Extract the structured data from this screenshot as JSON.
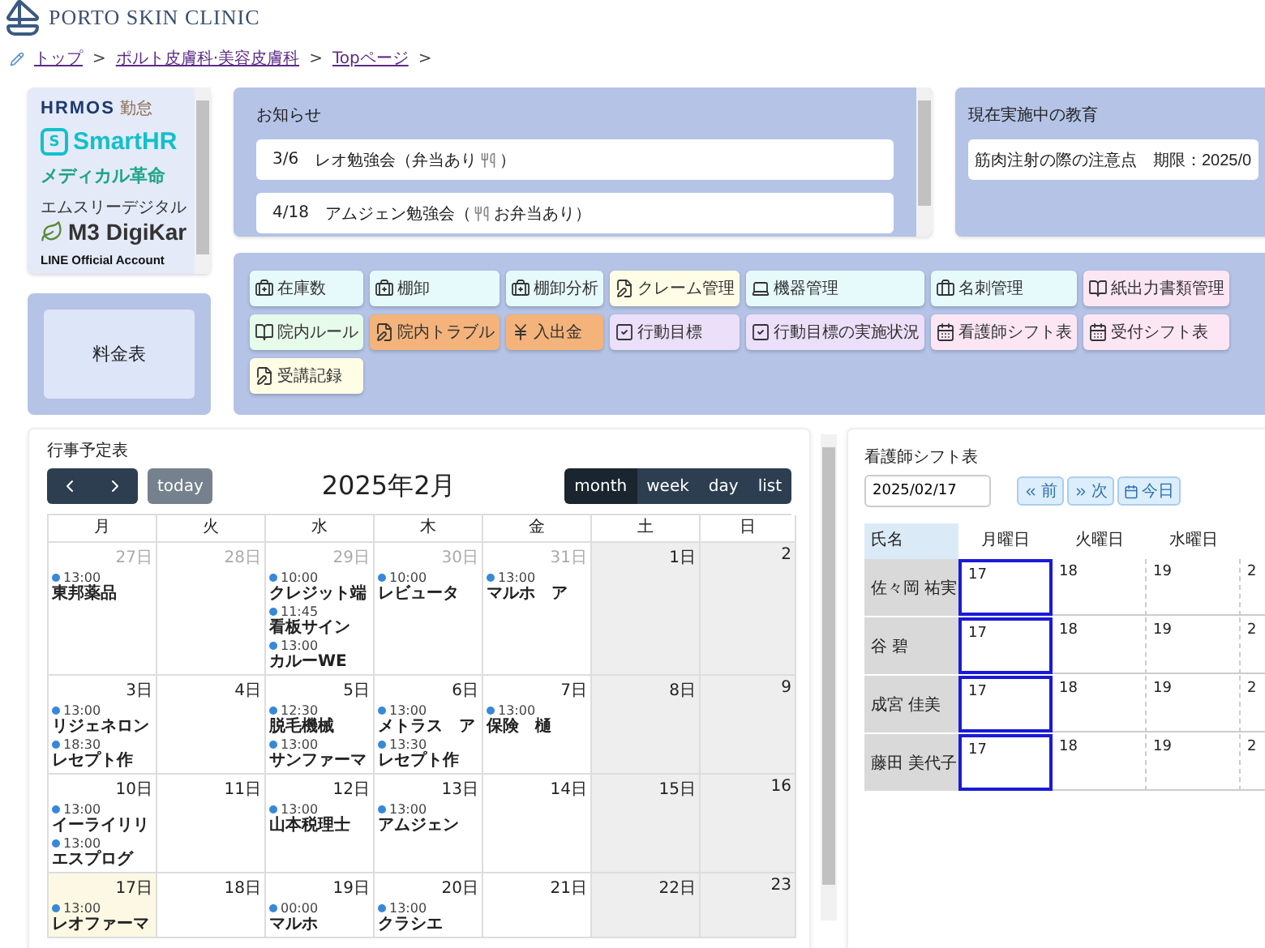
{
  "header": {
    "clinic_name": "PORTO SKIN CLINIC"
  },
  "breadcrumb": [
    {
      "label": "トップ",
      "separator": ">"
    },
    {
      "label": "ポルト皮膚科·美容皮膚科",
      "separator": ">"
    },
    {
      "label": "Topページ",
      "separator": ">"
    }
  ],
  "logos": [
    {
      "kind": "hrmos",
      "name": "HRMOS",
      "sub": "勤怠"
    },
    {
      "kind": "smarthr",
      "mark": "S",
      "name": "SmartHR"
    },
    {
      "kind": "medical",
      "name": "メディカル革命"
    },
    {
      "kind": "m3",
      "kana": "エムスリーデジタル",
      "name": "M3 DigiKar"
    },
    {
      "kind": "line",
      "name": "LINE Official Account"
    }
  ],
  "fee_panel": {
    "label": "料金表"
  },
  "notices": {
    "title": "お知らせ",
    "items": [
      {
        "date": "3/6",
        "before": "レオ勉強会（弁当あり",
        "after": "）"
      },
      {
        "date": "4/18",
        "before": "アムジェン勉強会（",
        "after": "お弁当あり）"
      }
    ]
  },
  "education": {
    "title": "現在実施中の教育",
    "items": [
      "筋肉注射の際の注意点　期限：2025/0"
    ]
  },
  "shortcuts": [
    {
      "label": "在庫数",
      "kind": "kit",
      "color": "#e6fafc"
    },
    {
      "label": "棚卸",
      "kind": "kit",
      "color": "#e6fafc"
    },
    {
      "label": "棚卸分析",
      "kind": "kit",
      "color": "#e6fafc"
    },
    {
      "label": "クレーム管理",
      "kind": "doc",
      "color": "#fffde6"
    },
    {
      "label": "機器管理",
      "kind": "laptop",
      "color": "#e6fafc"
    },
    {
      "label": "名刺管理",
      "kind": "briefcase",
      "color": "#e6fafc"
    },
    {
      "label": "紙出力書類管理",
      "kind": "book",
      "color": "#fde6f4"
    },
    {
      "label": "院内ルール",
      "kind": "book",
      "color": "#e6fbe9"
    },
    {
      "label": "院内トラブル",
      "kind": "doc",
      "color": "#f4b37a"
    },
    {
      "label": "入出金",
      "kind": "yen",
      "color": "#f4b37a"
    },
    {
      "label": "行動目標",
      "kind": "check",
      "color": "#ecdff9"
    },
    {
      "label": "行動目標の実施状況",
      "kind": "check",
      "color": "#ecdff9"
    },
    {
      "label": "看護師シフト表",
      "kind": "calendar",
      "color": "#fde6f4"
    },
    {
      "label": "受付シフト表",
      "kind": "calendar",
      "color": "#fde6f4"
    },
    {
      "label": "受講記録",
      "kind": "doc",
      "color": "#fffde6"
    }
  ],
  "calendar": {
    "title": "行事予定表",
    "month": "2025年2月",
    "today_label": "today",
    "today_disabled": true,
    "views": [
      {
        "label": "month",
        "selected": true
      },
      {
        "label": "week",
        "selected": false
      },
      {
        "label": "day",
        "selected": false
      },
      {
        "label": "list",
        "selected": false
      }
    ],
    "weekdays": [
      {
        "label": "月",
        "weekend": false
      },
      {
        "label": "火",
        "weekend": false
      },
      {
        "label": "水",
        "weekend": false
      },
      {
        "label": "木",
        "weekend": false
      },
      {
        "label": "金",
        "weekend": false
      },
      {
        "label": "土",
        "weekend": true
      },
      {
        "label": "日",
        "weekend": true
      }
    ],
    "weeks": [
      [
        {
          "day": "27日",
          "other_month": true,
          "today": false,
          "events": [
            {
              "time": "13:00",
              "title": "東邦薬品"
            }
          ]
        },
        {
          "day": "28日",
          "other_month": true,
          "today": false
        },
        {
          "day": "29日",
          "other_month": true,
          "today": false,
          "events": [
            {
              "time": "10:00",
              "title": "クレジット端"
            },
            {
              "time": "11:45",
              "title": "看板サイン"
            },
            {
              "time": "13:00",
              "title": "カルーWE"
            }
          ]
        },
        {
          "day": "30日",
          "other_month": true,
          "today": false,
          "events": [
            {
              "time": "10:00",
              "title": "レビュータ"
            }
          ]
        },
        {
          "day": "31日",
          "other_month": true,
          "today": false,
          "events": [
            {
              "time": "13:00",
              "title": "マルホ　ア"
            }
          ]
        },
        {
          "day": "1日",
          "other_month": false,
          "today": false
        },
        {
          "day": "2",
          "other_month": false,
          "today": false
        }
      ],
      [
        {
          "day": "3日",
          "other_month": false,
          "today": false,
          "events": [
            {
              "time": "13:00",
              "title": "リジェネロン"
            },
            {
              "time": "18:30",
              "title": "レセプト作"
            }
          ]
        },
        {
          "day": "4日",
          "other_month": false,
          "today": false
        },
        {
          "day": "5日",
          "other_month": false,
          "today": false,
          "events": [
            {
              "time": "12:30",
              "title": "脱毛機械"
            },
            {
              "time": "13:00",
              "title": "サンファーマ"
            }
          ]
        },
        {
          "day": "6日",
          "other_month": false,
          "today": false,
          "events": [
            {
              "time": "13:00",
              "title": "メトラス　ア"
            },
            {
              "time": "13:30",
              "title": "レセプト作"
            }
          ]
        },
        {
          "day": "7日",
          "other_month": false,
          "today": false,
          "events": [
            {
              "time": "13:00",
              "title": "保険　樋"
            }
          ]
        },
        {
          "day": "8日",
          "other_month": false,
          "today": false
        },
        {
          "day": "9",
          "other_month": false,
          "today": false
        }
      ],
      [
        {
          "day": "10日",
          "other_month": false,
          "today": false,
          "events": [
            {
              "time": "13:00",
              "title": "イーライリリ"
            },
            {
              "time": "13:00",
              "title": "エスプログ"
            }
          ]
        },
        {
          "day": "11日",
          "other_month": false,
          "today": false
        },
        {
          "day": "12日",
          "other_month": false,
          "today": false,
          "events": [
            {
              "time": "13:00",
              "title": "山本税理士"
            }
          ]
        },
        {
          "day": "13日",
          "other_month": false,
          "today": false,
          "events": [
            {
              "time": "13:00",
              "title": "アムジェン"
            }
          ]
        },
        {
          "day": "14日",
          "other_month": false,
          "today": false
        },
        {
          "day": "15日",
          "other_month": false,
          "today": false
        },
        {
          "day": "16",
          "other_month": false,
          "today": false
        }
      ],
      [
        {
          "day": "17日",
          "other_month": false,
          "today": true,
          "events": [
            {
              "time": "13:00",
              "title": "レオファーマ"
            }
          ]
        },
        {
          "day": "18日",
          "other_month": false,
          "today": false
        },
        {
          "day": "19日",
          "other_month": false,
          "today": false,
          "events": [
            {
              "time": "00:00",
              "title": "マルホ"
            }
          ]
        },
        {
          "day": "20日",
          "other_month": false,
          "today": false,
          "events": [
            {
              "time": "13:00",
              "title": "クラシエ"
            }
          ]
        },
        {
          "day": "21日",
          "other_month": false,
          "today": false
        },
        {
          "day": "22日",
          "other_month": false,
          "today": false
        },
        {
          "day": "23",
          "other_month": false,
          "today": false
        }
      ]
    ]
  },
  "shift_table": {
    "title": "看護師シフト表",
    "date": "2025/02/17",
    "nav": [
      {
        "kind": "prev",
        "label": "前"
      },
      {
        "kind": "next",
        "label": "次"
      },
      {
        "kind": "today",
        "label": "今日"
      }
    ],
    "name_header": "氏名",
    "days": [
      {
        "label": "月曜日",
        "today": true
      },
      {
        "label": "火曜日",
        "today": false
      },
      {
        "label": "水曜日",
        "today": false
      }
    ],
    "rows": [
      {
        "name": "佐々岡 祐実",
        "cells": [
          "17",
          "18",
          "19",
          "2"
        ]
      },
      {
        "name": "谷 碧",
        "cells": [
          "17",
          "18",
          "19",
          "2"
        ]
      },
      {
        "name": "成宮 佳美",
        "cells": [
          "17",
          "18",
          "19",
          "2"
        ]
      },
      {
        "name": "藤田 美代子",
        "cells": [
          "17",
          "18",
          "19",
          "2"
        ]
      }
    ]
  }
}
